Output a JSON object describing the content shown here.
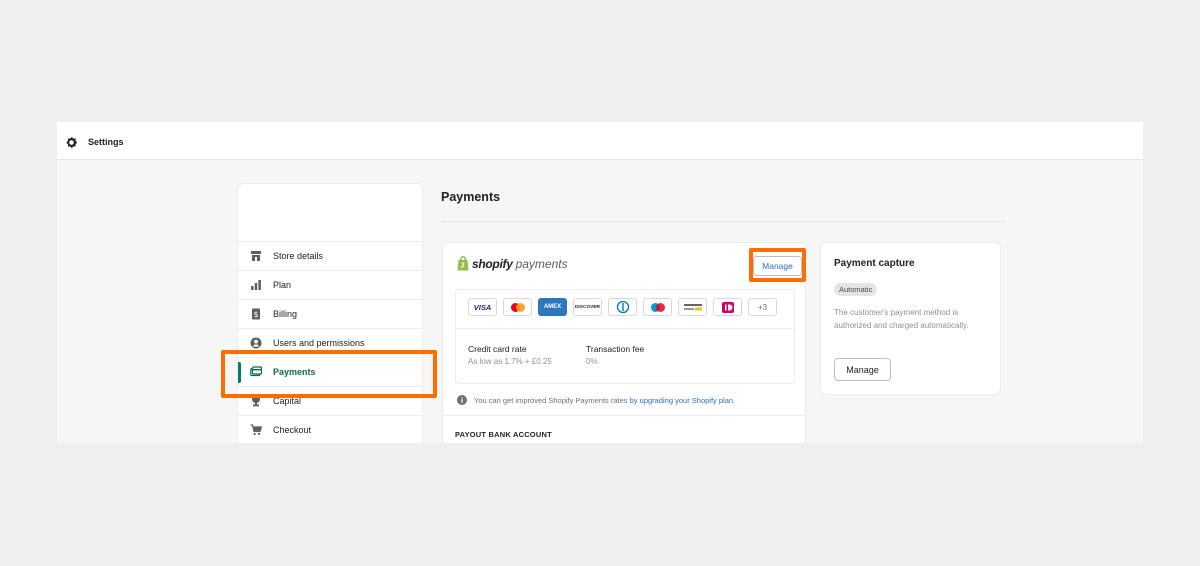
{
  "topbar": {
    "title": "Settings",
    "icon": "gear-icon"
  },
  "sidebar": {
    "items": [
      {
        "label": "Store details",
        "icon": "store-icon"
      },
      {
        "label": "Plan",
        "icon": "plan-icon"
      },
      {
        "label": "Billing",
        "icon": "billing-icon"
      },
      {
        "label": "Users and permissions",
        "icon": "user-icon"
      },
      {
        "label": "Payments",
        "icon": "payments-icon",
        "active": true
      },
      {
        "label": "Capital",
        "icon": "capital-icon"
      },
      {
        "label": "Checkout",
        "icon": "cart-icon"
      }
    ]
  },
  "main": {
    "title": "Payments",
    "provider": {
      "brand_strong": "shopify",
      "brand_light": "payments",
      "manage_label": "Manage",
      "methods": [
        "VISA",
        "mastercard",
        "AMEX",
        "DISCOVER",
        "diners",
        "maestro",
        "other",
        "ideal"
      ],
      "more_label": "+3",
      "credit_card_rate_label": "Credit card rate",
      "credit_card_rate_value": "As low as 1.7% + £0.25",
      "transaction_fee_label": "Transaction fee",
      "transaction_fee_value": "0%",
      "notice_text": "You can get improved Shopify Payments rates ",
      "notice_link": "by upgrading your Shopify plan.",
      "payout_heading": "PAYOUT BANK ACCOUNT"
    },
    "capture": {
      "title": "Payment capture",
      "badge": "Automatic",
      "description": "The customer's payment method is authorized and charged automatically.",
      "button_label": "Manage"
    }
  },
  "colors": {
    "accent": "#008060",
    "highlight": "#ff6d00",
    "link": "#2c6ecb"
  }
}
